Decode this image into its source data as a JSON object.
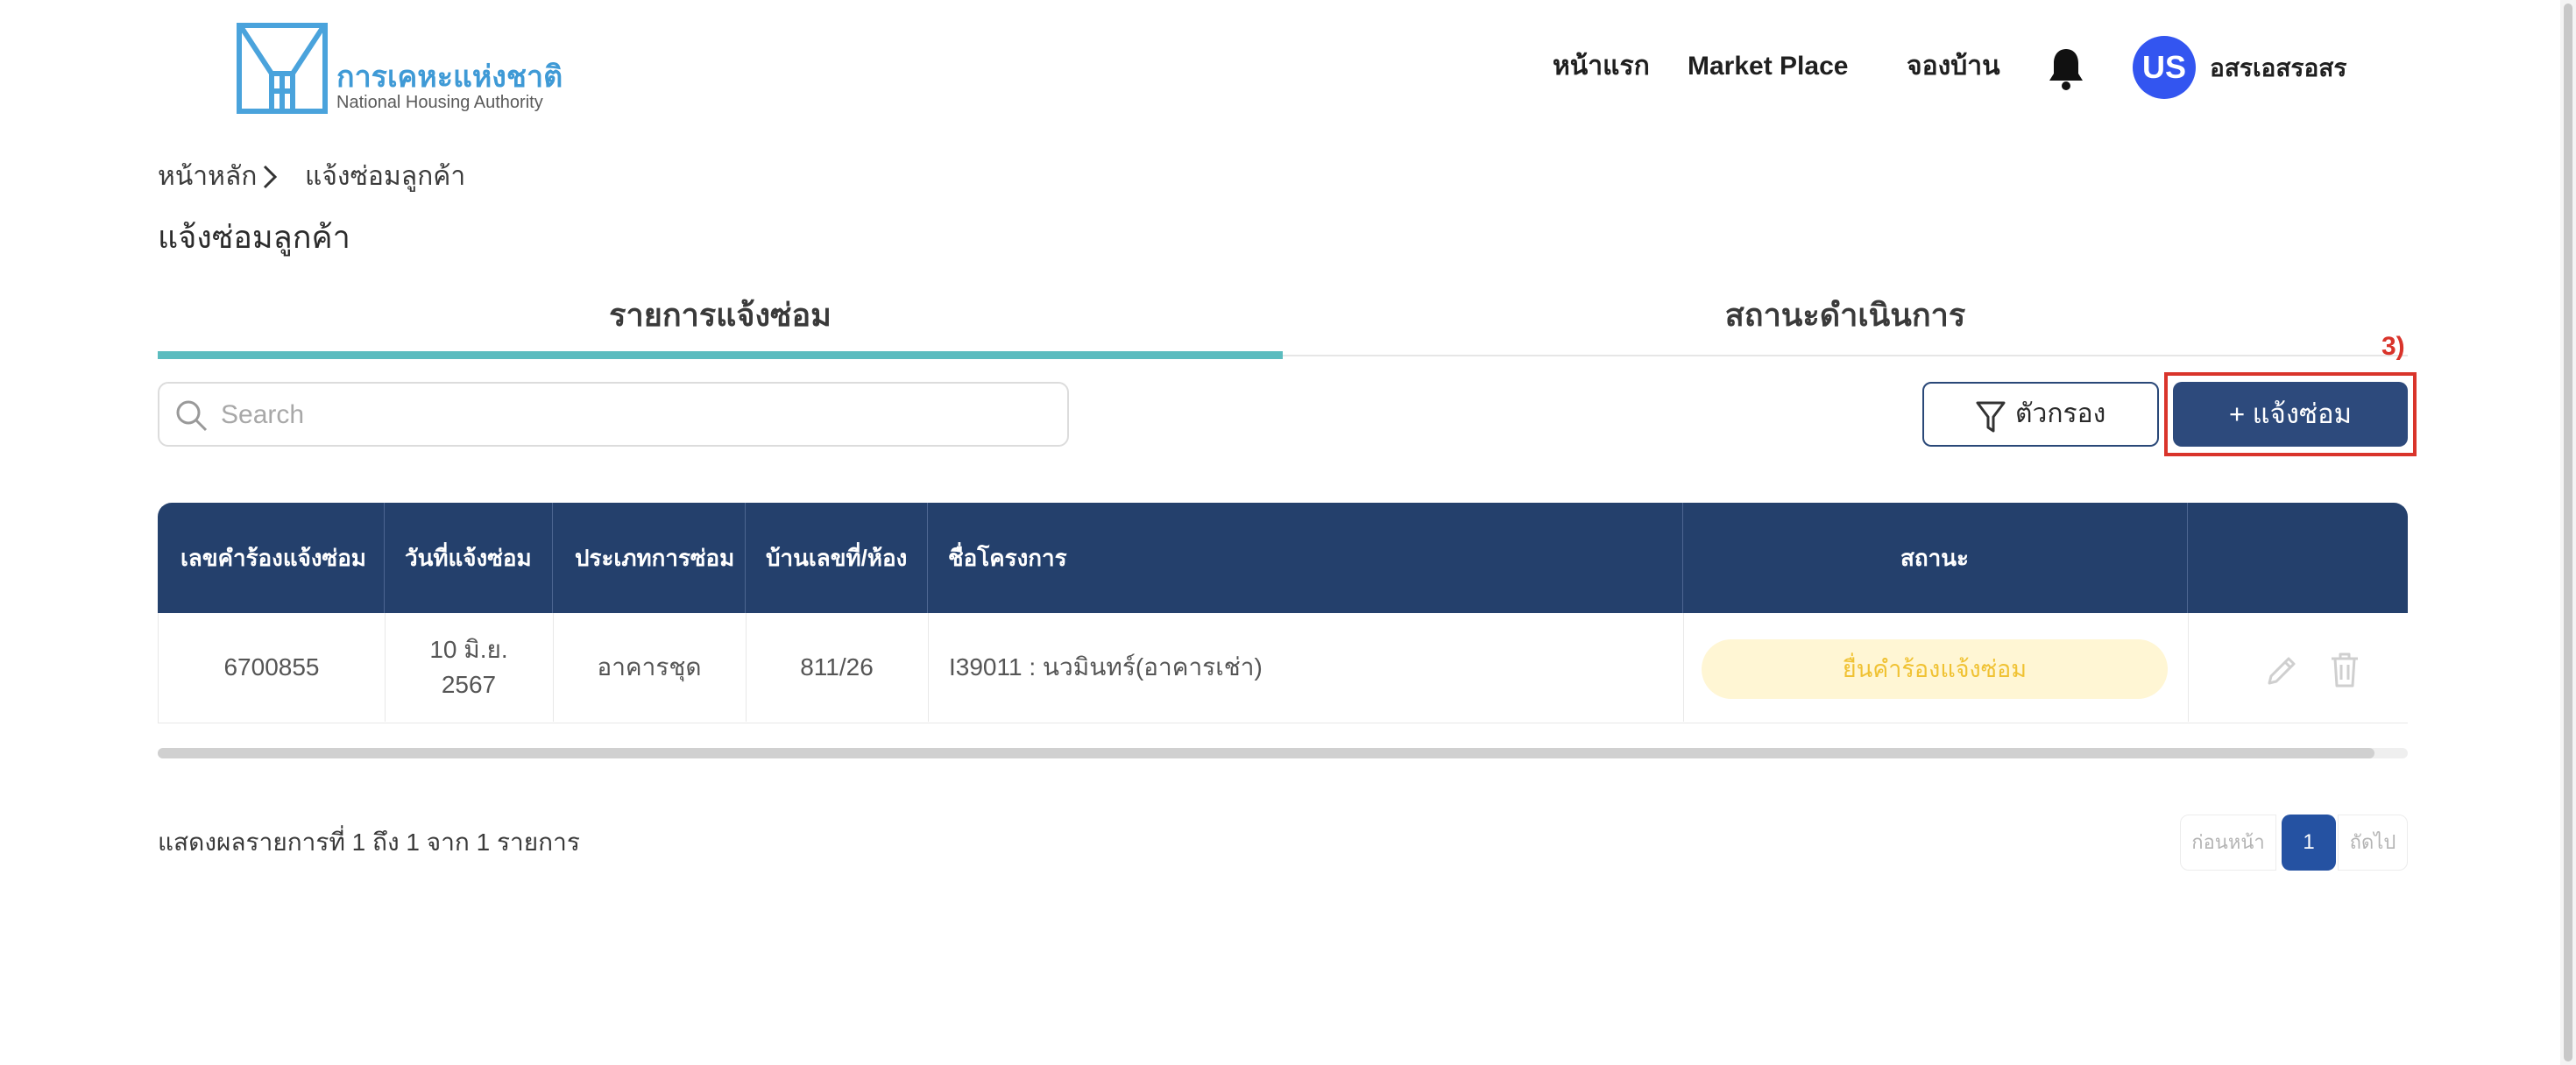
{
  "header": {
    "logo_th": "การเคหะแห่งชาติ",
    "logo_en": "National Housing Authority",
    "nav": [
      {
        "label": "หน้าแรก"
      },
      {
        "label": "Market Place"
      },
      {
        "label": "จองบ้าน"
      }
    ],
    "avatar_initials": "US",
    "user_name": "อสรเอสรอสร",
    "bell_icon": "bell-icon"
  },
  "breadcrumb": {
    "home": "หน้าหลัก",
    "current": "แจ้งซ่อมลูกค้า"
  },
  "page_title": "แจ้งซ่อมลูกค้า",
  "tabs": [
    {
      "label": "รายการแจ้งซ่อม",
      "active": true
    },
    {
      "label": "สถานะดำเนินการ",
      "active": false
    }
  ],
  "search": {
    "placeholder": "Search",
    "value": ""
  },
  "toolbar": {
    "filter_label": "ตัวกรอง",
    "add_label": "+ แจ้งซ่อม",
    "annotation": "3)"
  },
  "table": {
    "columns": [
      "เลขคำร้องแจ้งซ่อม",
      "วันที่แจ้งซ่อม",
      "ประเภทการซ่อม",
      "บ้านเลขที่/ห้อง",
      "ชื่อโครงการ",
      "สถานะ",
      ""
    ],
    "rows": [
      {
        "request_no": "6700855",
        "date_line1": "10 มิ.ย.",
        "date_line2": "2567",
        "type": "อาคารชุด",
        "house_no": "811/26",
        "project": "I39011 : นวมินทร์(อาคารเช่า)",
        "status": "ยื่นคำร้องแจ้งซ่อม"
      }
    ]
  },
  "footer": {
    "summary": "แสดงผลรายการที่ 1 ถึง 1 จาก 1 รายการ",
    "prev": "ก่อนหน้า",
    "page": "1",
    "next": "ถัดไป"
  },
  "colors": {
    "primary": "#2d4a7c",
    "header_bg": "#24406c",
    "tab_active": "#5bbcbf",
    "status_bg": "#fff6d4",
    "status_text": "#f0c233",
    "highlight": "#d9342b",
    "avatar": "#3355f0"
  }
}
